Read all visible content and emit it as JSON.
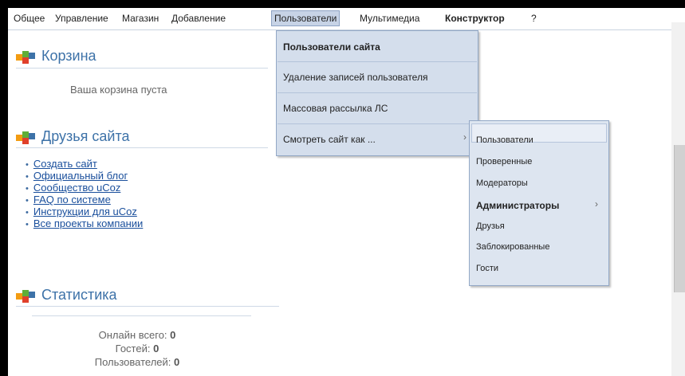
{
  "menubar": {
    "items": [
      "Общее",
      "Управление",
      "Магазин",
      "Добавление",
      "Пользователи",
      "Мультимедиа",
      "Конструктор",
      "?"
    ]
  },
  "cart": {
    "title": "Корзина",
    "empty_text": "Ваша корзина пуста"
  },
  "friends": {
    "title": "Друзья сайта",
    "links": [
      "Создать сайт",
      "Официальный блог",
      "Сообщество uCoz",
      "FAQ по системе",
      "Инструкции для uCoz",
      "Все проекты компании"
    ]
  },
  "stats": {
    "title": "Статистика",
    "online_label": "Онлайн всего:",
    "online_value": "0",
    "guests_label": "Гостей:",
    "guests_value": "0",
    "users_label": "Пользователей:",
    "users_value": "0"
  },
  "users_menu": {
    "items": [
      "Пользователи сайта",
      "Удаление записей пользователя",
      "Массовая рассылка ЛС",
      "Смотреть сайт как ..."
    ],
    "arrow": "›"
  },
  "view_as_menu": {
    "items": [
      "Пользователи",
      "Проверенные",
      "Модераторы",
      "Администраторы",
      "Друзья",
      "Заблокированные",
      "Гости"
    ],
    "arrow": "›"
  },
  "colors": {
    "accent": "#3d72a8",
    "link": "#1a4f9c",
    "menu_bg": "#d4deec",
    "logo_orange": "#f39c12",
    "logo_green": "#5fae37",
    "logo_blue": "#3d72a8",
    "logo_red": "#e0402b"
  },
  "icons": [
    "ucoz-logo-icon",
    "bullet-icon",
    "submenu-arrow-icon"
  ]
}
